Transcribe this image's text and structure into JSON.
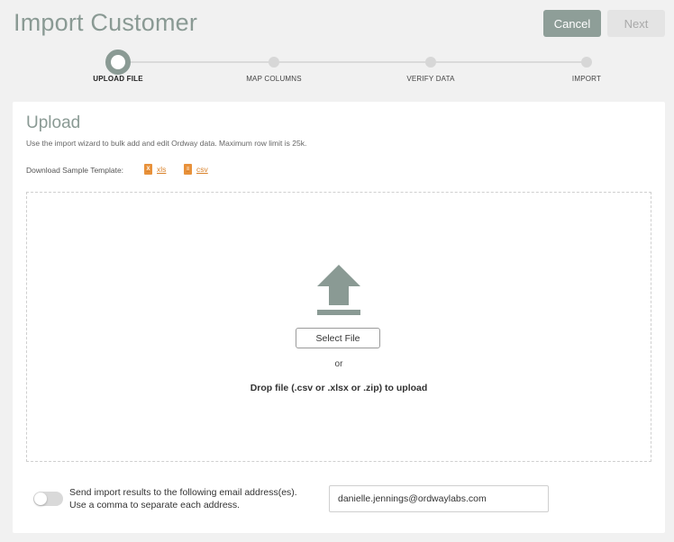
{
  "header": {
    "title": "Import Customer",
    "cancel_label": "Cancel",
    "next_label": "Next"
  },
  "steps": [
    {
      "label": "UPLOAD FILE",
      "active": true
    },
    {
      "label": "MAP COLUMNS",
      "active": false
    },
    {
      "label": "VERIFY DATA",
      "active": false
    },
    {
      "label": "IMPORT",
      "active": false
    }
  ],
  "upload": {
    "heading": "Upload",
    "description": "Use the import wizard to bulk add and edit Ordway data. Maximum row limit is 25k.",
    "sample_label": "Download Sample Template:",
    "xls_label": "xls",
    "csv_label": "csv",
    "select_file_label": "Select File",
    "or_text": "or",
    "drop_text": "Drop file (.csv or .xlsx or .zip) to upload"
  },
  "notify": {
    "line1": "Send import results to the following email address(es).",
    "line2": "Use a comma to separate each address.",
    "enabled": false,
    "email_value": "danielle.jennings@ordwaylabs.com"
  },
  "colors": {
    "accent": "#8a9a94",
    "link": "#d9822b"
  }
}
